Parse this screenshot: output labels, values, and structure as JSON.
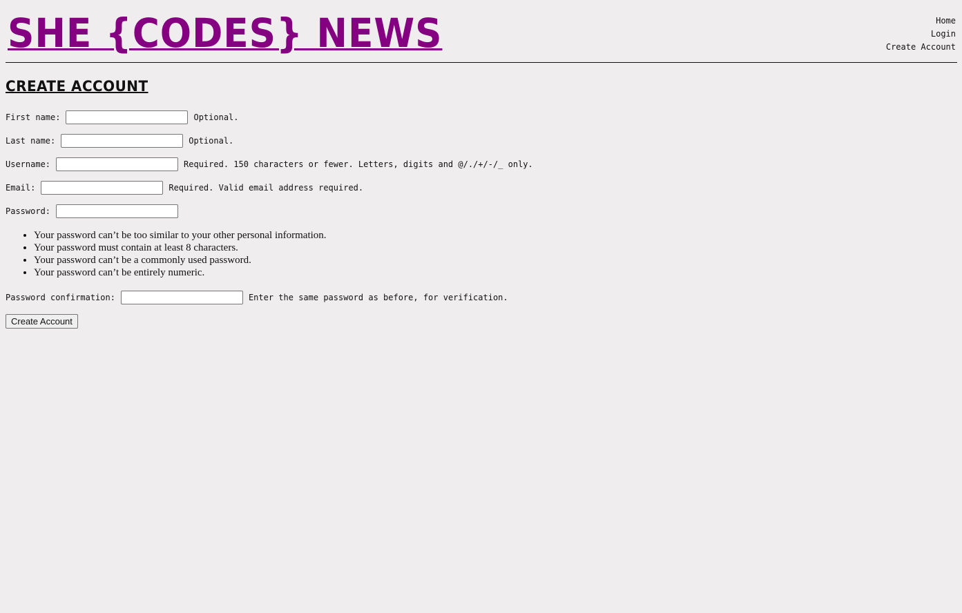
{
  "header": {
    "logo": "SHE {CODES} NEWS",
    "nav": [
      "Home",
      "Login",
      "Create Account"
    ]
  },
  "page": {
    "title": "CREATE ACCOUNT"
  },
  "form": {
    "first_name": {
      "label": "First name:",
      "value": "",
      "help": "Optional."
    },
    "last_name": {
      "label": "Last name:",
      "value": "",
      "help": "Optional."
    },
    "username": {
      "label": "Username:",
      "value": "",
      "help": "Required. 150 characters or fewer. Letters, digits and @/./+/-/_ only."
    },
    "email": {
      "label": "Email:",
      "value": "",
      "help": "Required. Valid email address required."
    },
    "password": {
      "label": "Password:",
      "value": ""
    },
    "password_rules": [
      "Your password can’t be too similar to your other personal information.",
      "Your password must contain at least 8 characters.",
      "Your password can’t be a commonly used password.",
      "Your password can’t be entirely numeric."
    ],
    "password_confirmation": {
      "label": "Password confirmation:",
      "value": "",
      "help": "Enter the same password as before, for verification."
    },
    "submit_label": "Create Account"
  },
  "colors": {
    "background": "#efedee",
    "brand": "#850081"
  }
}
